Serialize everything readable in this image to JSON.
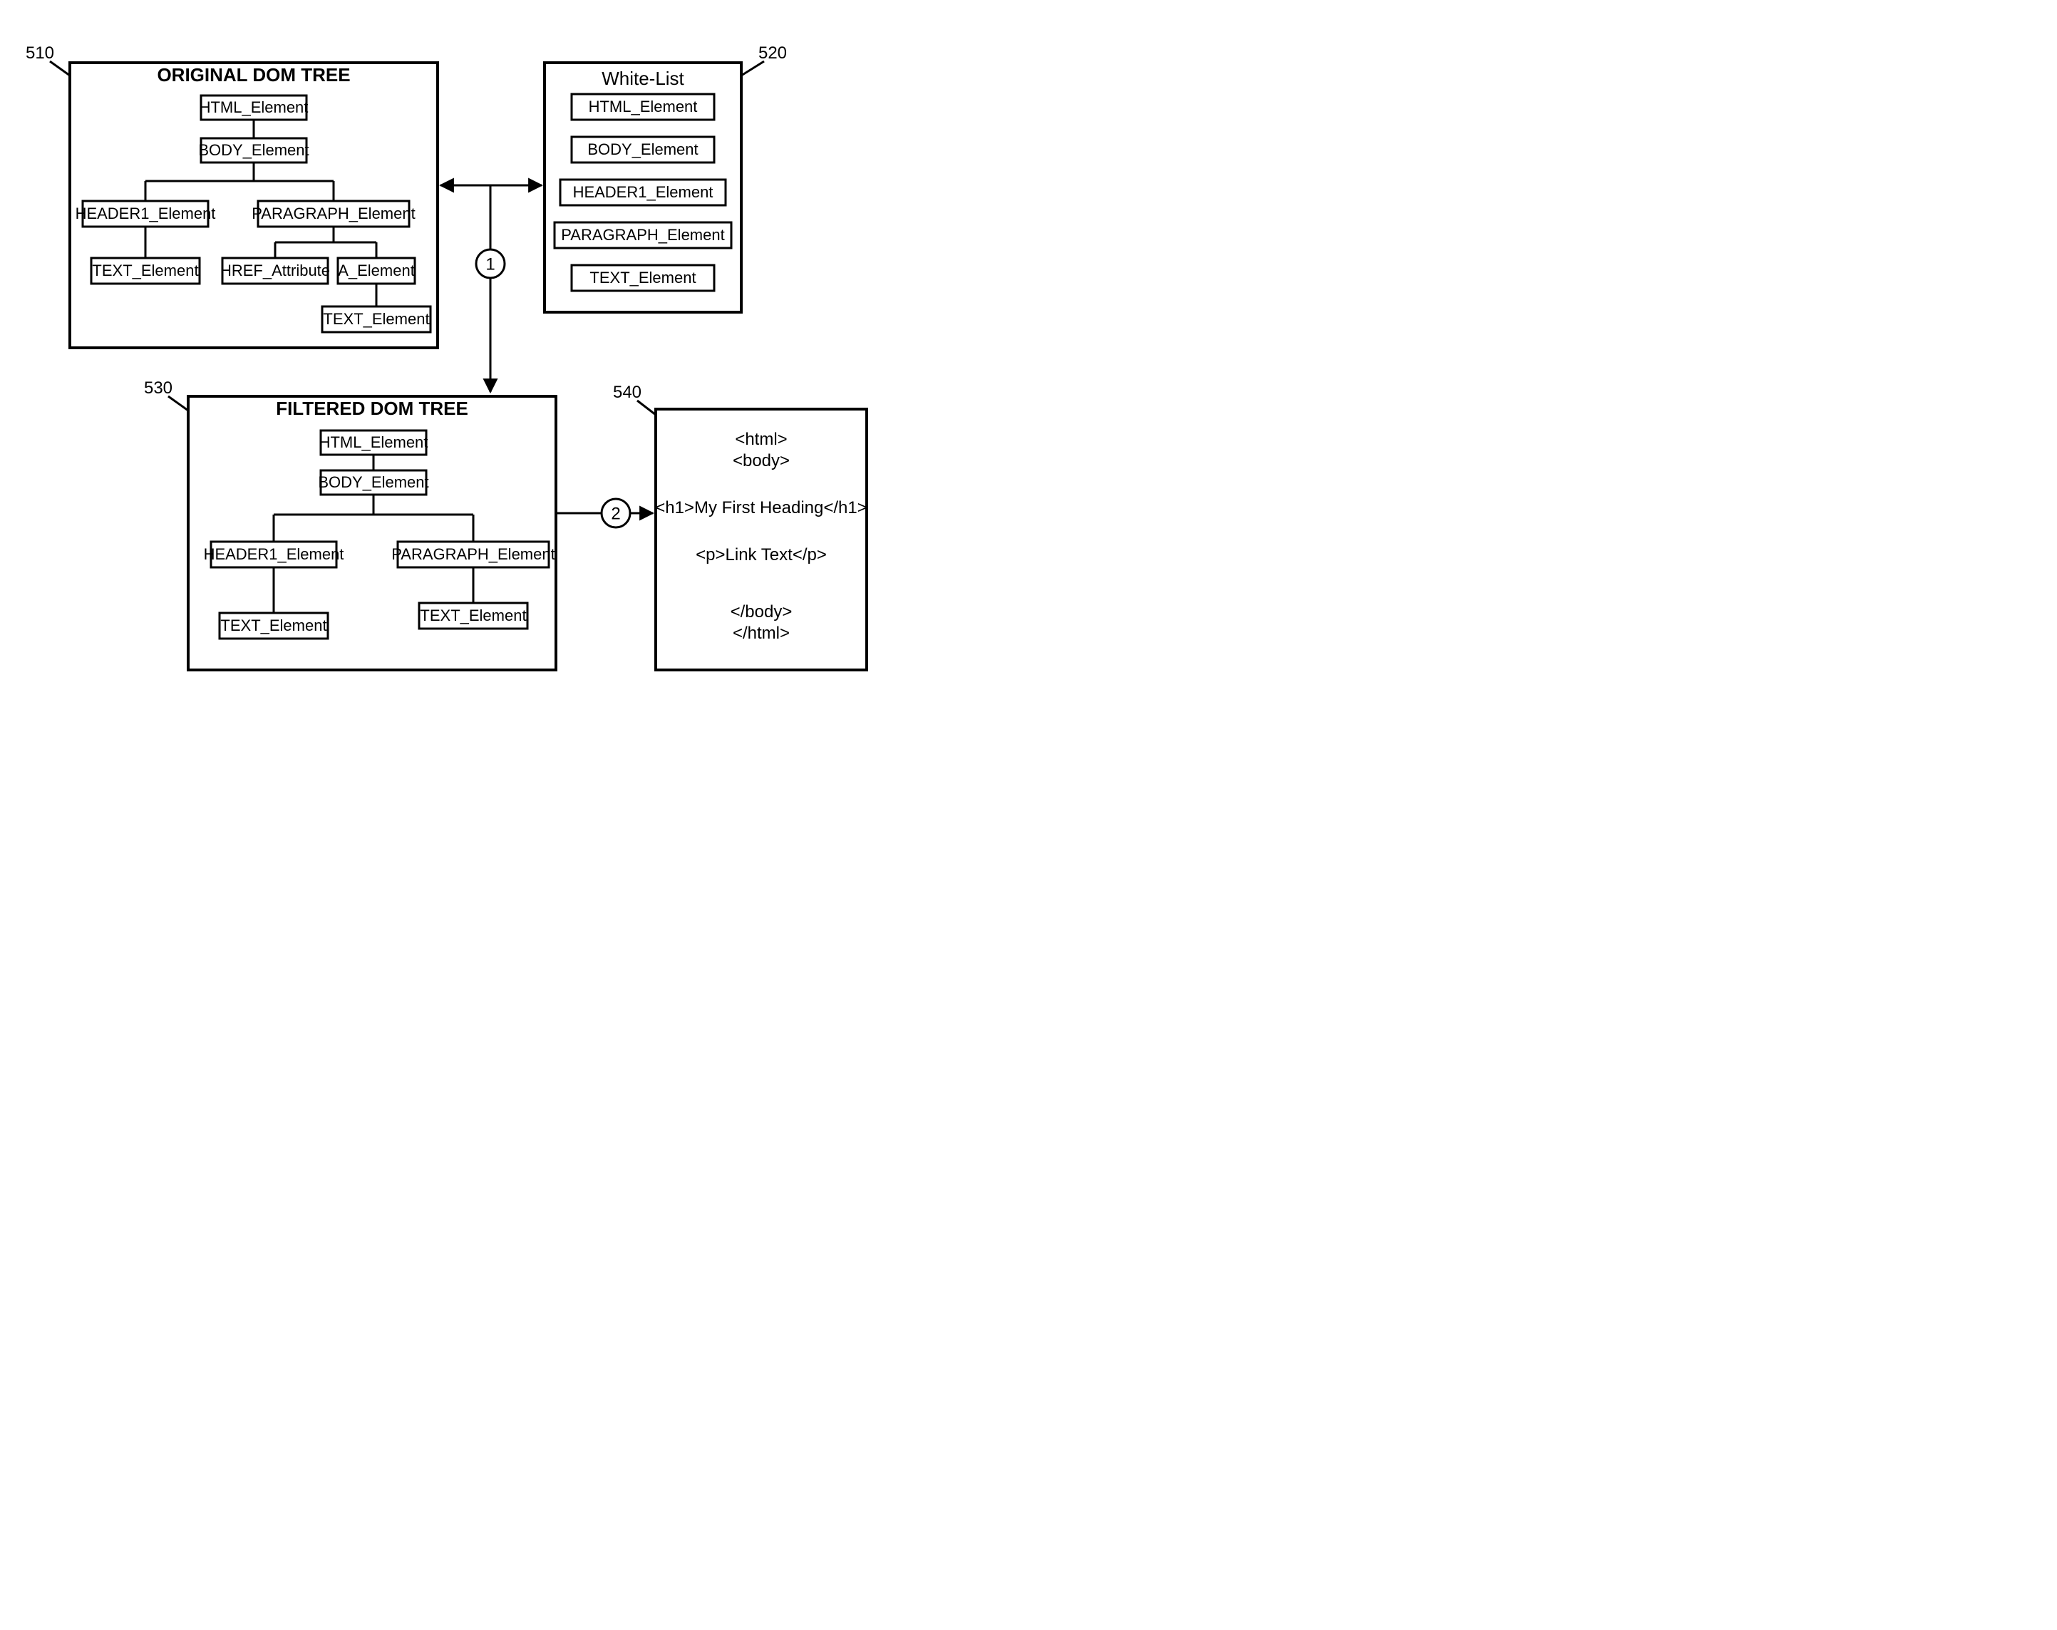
{
  "refs": {
    "r510": "510",
    "r520": "520",
    "r530": "530",
    "r540": "540"
  },
  "titles": {
    "original": "ORIGINAL DOM TREE",
    "whitelist": "White-List",
    "filtered": "FILTERED DOM TREE"
  },
  "nodes": {
    "html": "HTML_Element",
    "body": "BODY_Element",
    "header1": "HEADER1_Element",
    "paragraph": "PARAGRAPH_Element",
    "text": "TEXT_Element",
    "href": "HREF_Attribute",
    "a": "A_Element"
  },
  "code": {
    "l1": "<html>",
    "l2": "<body>",
    "l3": "<h1>My First Heading</h1>",
    "l4": "<p>Link Text</p>",
    "l5": "</body>",
    "l6": "</html>"
  },
  "steps": {
    "s1": "1",
    "s2": "2"
  }
}
